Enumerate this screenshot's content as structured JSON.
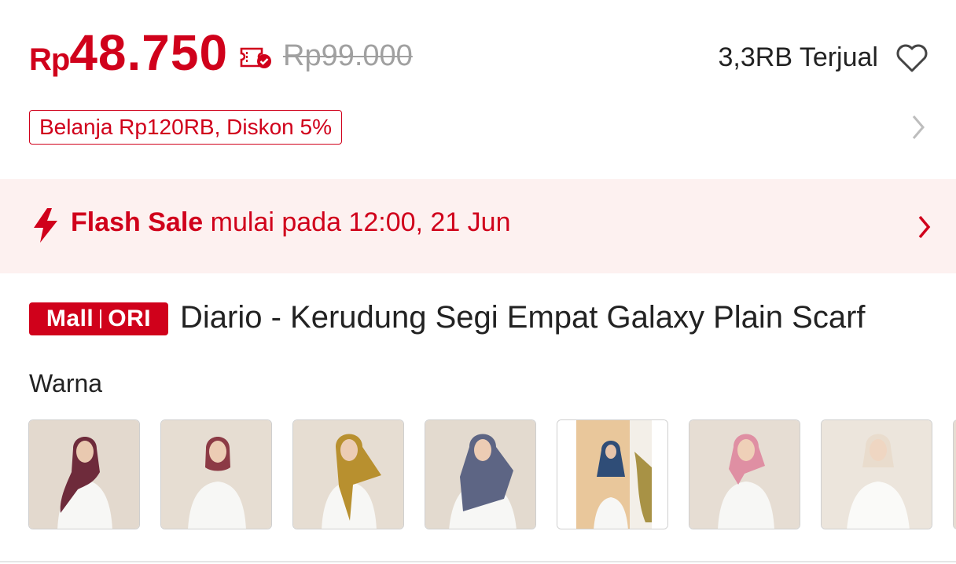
{
  "price": {
    "currency": "Rp",
    "current": "48.750",
    "original": "Rp99.000",
    "sold": "3,3RB Terjual",
    "accent": "#d0011b"
  },
  "promo": {
    "label": "Belanja Rp120RB, Diskon 5%"
  },
  "flash_sale": {
    "title": "Flash Sale",
    "detail": "mulai pada 12:00, 21 Jun",
    "background": "#fdf1f0"
  },
  "product": {
    "badge_left": "Mall",
    "badge_right": "ORI",
    "title": "Diario - Kerudung Segi Empat Galaxy Plain Scarf"
  },
  "variant": {
    "label": "Warna",
    "swatches": [
      {
        "name": "maroon",
        "scarf": "#6e2b3b",
        "bg": "#e3d9ce"
      },
      {
        "name": "rose-brown",
        "scarf": "#8c3a45",
        "bg": "#e6ddd2"
      },
      {
        "name": "mustard",
        "scarf": "#b8902f",
        "bg": "#e6ddd2"
      },
      {
        "name": "slate-blue",
        "scarf": "#5d6584",
        "bg": "#e3dacf"
      },
      {
        "name": "navy-studio",
        "scarf": "#2f4d77",
        "bg": "#efe6dc"
      },
      {
        "name": "pink",
        "scarf": "#df8fa3",
        "bg": "#e6ddd3"
      },
      {
        "name": "cream",
        "scarf": "#e9dccd",
        "bg": "#ece5dc"
      }
    ]
  },
  "icons": [
    "voucher-icon",
    "heart-icon",
    "chevron-right-icon",
    "lightning-icon"
  ]
}
